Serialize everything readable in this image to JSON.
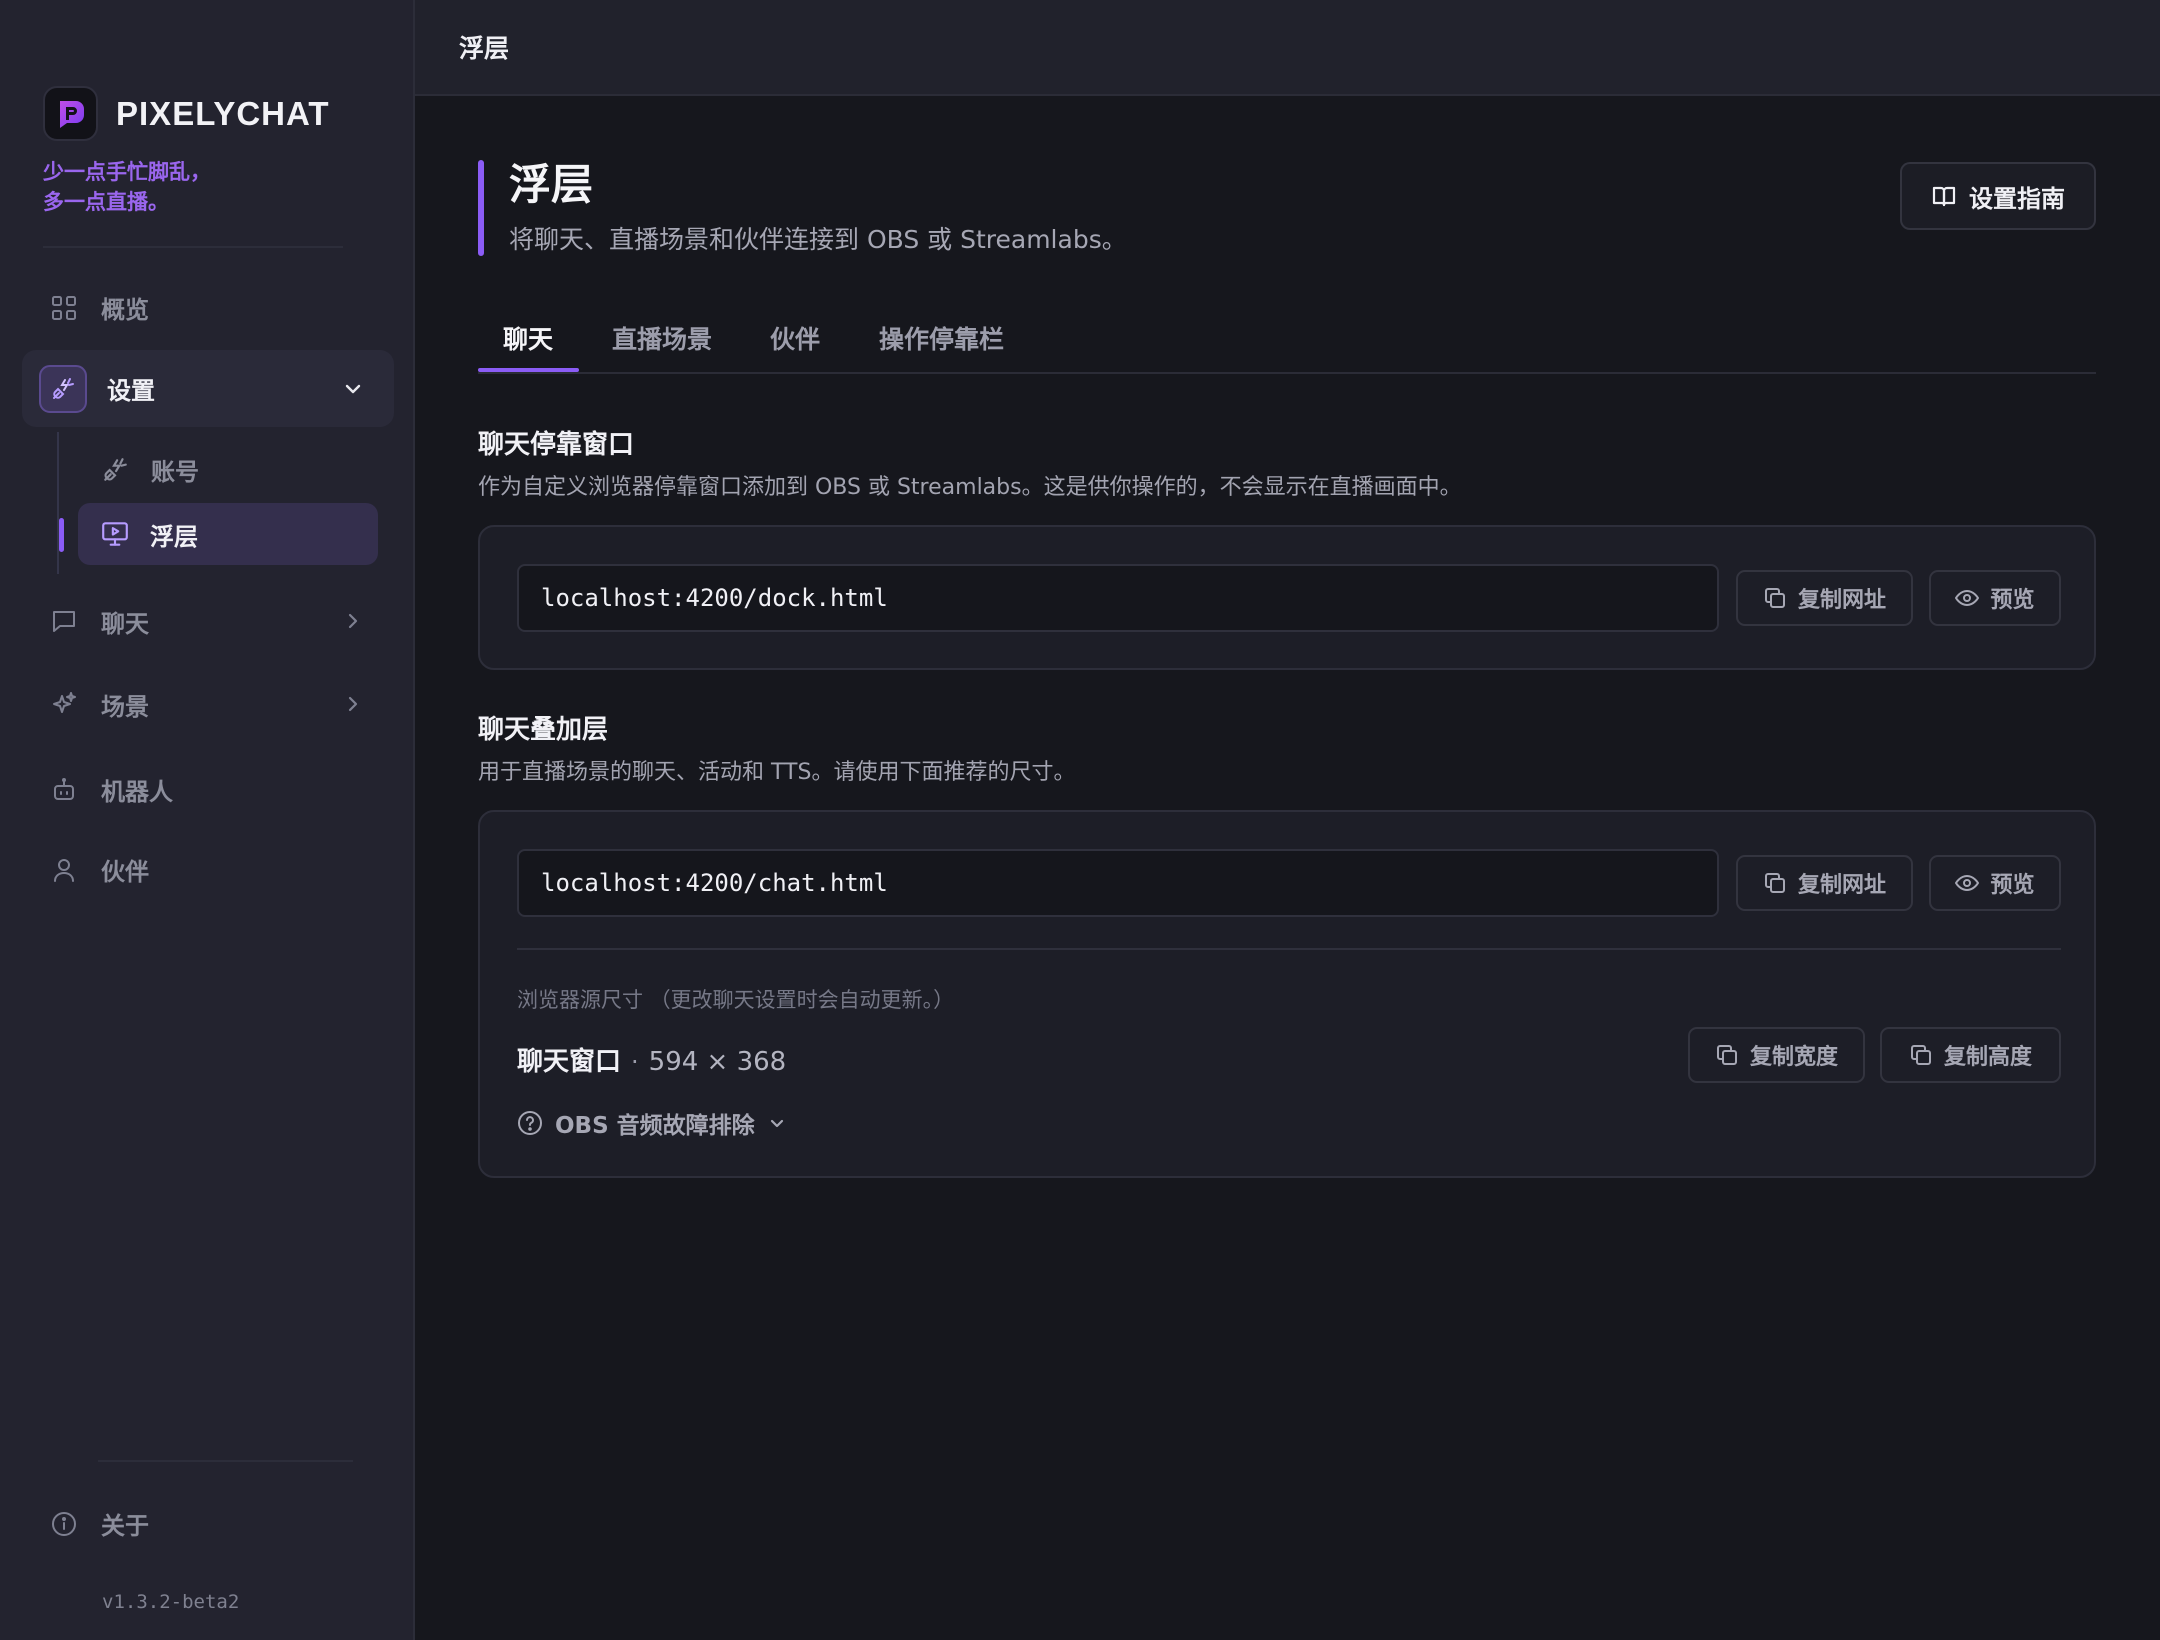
{
  "app": {
    "name": "PIXELYCHAT",
    "tagline": [
      "少一点手忙脚乱，",
      "多一点直播。"
    ],
    "version": "v1.3.2-beta2"
  },
  "sidebar": {
    "overview": "概览",
    "settings": "设置",
    "settings_children": {
      "account": "账号",
      "overlay": "浮层"
    },
    "chat": "聊天",
    "scenes": "场景",
    "bots": "机器人",
    "partners": "伙伴",
    "about": "关于"
  },
  "topbar": {
    "breadcrumb": "浮层"
  },
  "page": {
    "title": "浮层",
    "subtitle": "将聊天、直播场景和伙伴连接到 OBS 或 Streamlabs。",
    "guide_button": "设置指南"
  },
  "tabs": [
    "聊天",
    "直播场景",
    "伙伴",
    "操作停靠栏"
  ],
  "active_tab": 0,
  "dock_section": {
    "title": "聊天停靠窗口",
    "description": "作为自定义浏览器停靠窗口添加到 OBS 或 Streamlabs。这是供你操作的，不会显示在直播画面中。",
    "url": "localhost:4200/dock.html",
    "copy_url": "复制网址",
    "preview": "预览"
  },
  "overlay_section": {
    "title": "聊天叠加层",
    "description": "用于直播场景的聊天、活动和 TTS。请使用下面推荐的尺寸。",
    "url": "localhost:4200/chat.html",
    "copy_url": "复制网址",
    "preview": "预览",
    "size_caption": "浏览器源尺寸 （更改聊天设置时会自动更新。）",
    "size_name": "聊天窗口",
    "size_separator": "·",
    "size_value": "594 × 368",
    "copy_width": "复制宽度",
    "copy_height": "复制高度",
    "troubleshoot": "OBS 音频故障排除"
  },
  "colors": {
    "accent": "#8b5cf6",
    "tagline": "#9a66ee",
    "background": "#16171d",
    "sidebar": "#23232f",
    "card": "#1d1e27"
  }
}
